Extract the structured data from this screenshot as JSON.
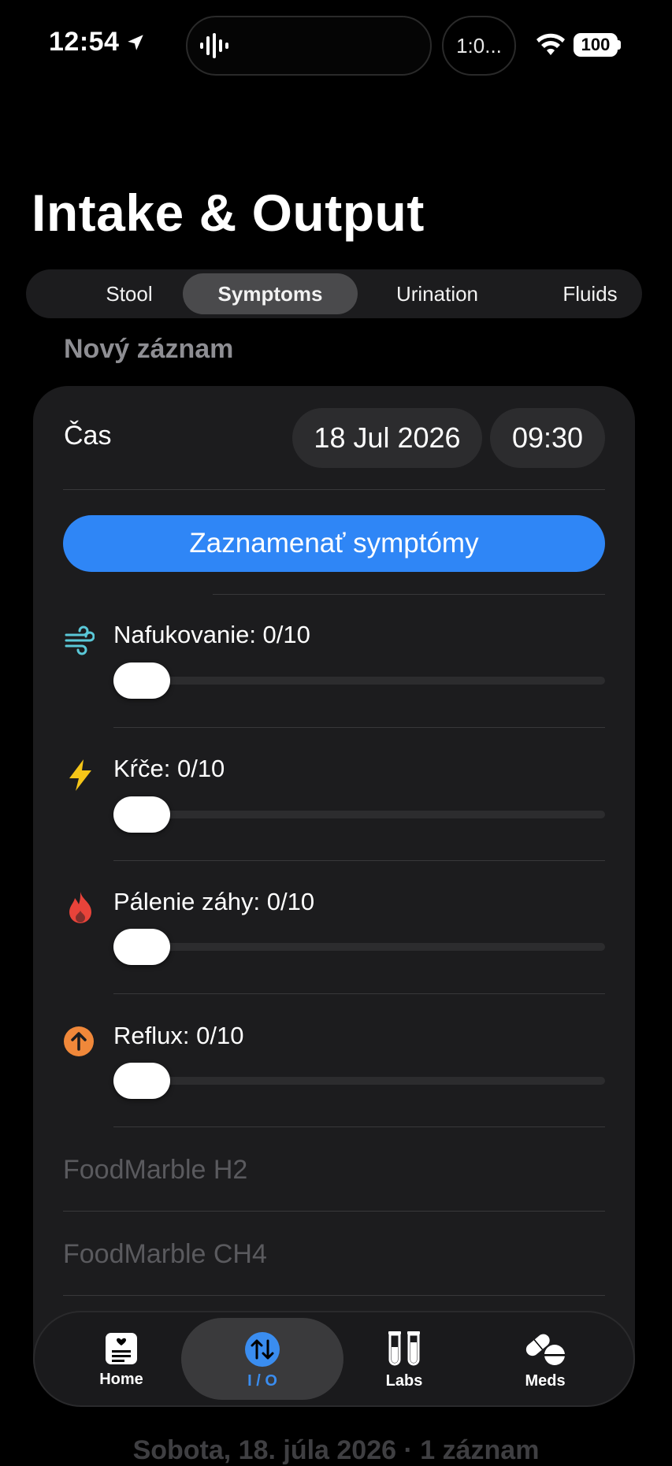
{
  "status_bar": {
    "time": "12:54",
    "live_activity": "1:0...",
    "battery": "100"
  },
  "title": "Intake & Output",
  "tabs": [
    {
      "label": "Stool",
      "active": false
    },
    {
      "label": "Symptoms",
      "active": true
    },
    {
      "label": "Urination",
      "active": false
    },
    {
      "label": "Fluids",
      "active": false
    }
  ],
  "section_label": "Nový záznam",
  "entry": {
    "time_label": "Čas",
    "date": "18 Jul 2026",
    "time": "09:30",
    "record_button": "Zaznamenať symptómy"
  },
  "symptoms": [
    {
      "label": "Nafukovanie: 0/10",
      "value": 0,
      "max": 10,
      "icon": "wind-icon",
      "color": "#5ac8d8"
    },
    {
      "label": "Kŕče: 0/10",
      "value": 0,
      "max": 10,
      "icon": "bolt-icon",
      "color": "#f5c518"
    },
    {
      "label": "Pálenie záhy: 0/10",
      "value": 0,
      "max": 10,
      "icon": "flame-icon",
      "color": "#e8433a"
    },
    {
      "label": "Reflux: 0/10",
      "value": 0,
      "max": 10,
      "icon": "arrow-up-circle-icon",
      "color": "#f0883a"
    }
  ],
  "foodmarble": {
    "h2": "FoodMarble H2",
    "ch4": "FoodMarble CH4"
  },
  "tabbar": [
    {
      "label": "Home",
      "icon": "home-card-icon",
      "active": false
    },
    {
      "label": "I / O",
      "icon": "arrows-up-down-icon",
      "active": true
    },
    {
      "label": "Labs",
      "icon": "test-tubes-icon",
      "active": false
    },
    {
      "label": "Meds",
      "icon": "pills-icon",
      "active": false
    }
  ],
  "footer": "Sobota, 18. júla 2026 · 1 záznam",
  "colors": {
    "accent": "#2f86f6",
    "background": "#000000",
    "card": "#1c1c1e"
  }
}
